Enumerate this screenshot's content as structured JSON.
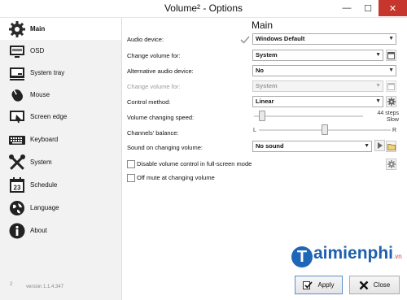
{
  "window": {
    "title": "Volume² - Options",
    "minimize": "—",
    "maximize": "☐",
    "close": "✕"
  },
  "sidebar": {
    "items": [
      {
        "label": "Main",
        "icon": "gear-icon"
      },
      {
        "label": "OSD",
        "icon": "monitor-icon"
      },
      {
        "label": "System tray",
        "icon": "system-tray-icon"
      },
      {
        "label": "Mouse",
        "icon": "mouse-icon"
      },
      {
        "label": "Screen edge",
        "icon": "screen-edge-icon"
      },
      {
        "label": "Keyboard",
        "icon": "keyboard-icon"
      },
      {
        "label": "System",
        "icon": "tools-icon"
      },
      {
        "label": "Schedule",
        "icon": "calendar-icon"
      },
      {
        "label": "Language",
        "icon": "globe-icon"
      },
      {
        "label": "About",
        "icon": "info-icon"
      }
    ],
    "version_superscript": "2",
    "version": "version 1.1.4.347"
  },
  "main": {
    "heading": "Main",
    "audio_device": {
      "label": "Audio device:",
      "value": "Windows Default"
    },
    "change_volume_for": {
      "label": "Change volume for:",
      "value": "System"
    },
    "alt_audio_device": {
      "label": "Alternative audio device:",
      "value": "No"
    },
    "alt_change_volume_for": {
      "label": "Change volume for:",
      "value": "System"
    },
    "control_method": {
      "label": "Control method:",
      "value": "Linear"
    },
    "volume_speed": {
      "label": "Volume changing speed:",
      "steps": "44 steps",
      "speed": "Slow",
      "level": 0.05
    },
    "balance": {
      "label": "Channels' balance:",
      "left": "L",
      "right": "R",
      "level": 0.5
    },
    "sound_on_change": {
      "label": "Sound on changing volume:",
      "value": "No sound"
    },
    "disable_fullscreen": {
      "label": "Disable volume control in full-screen mode",
      "checked": false
    },
    "off_mute": {
      "label": "Off mute at changing volume",
      "checked": false
    }
  },
  "buttons": {
    "apply": "Apply",
    "close": "Close"
  },
  "watermark": {
    "brand": "aimienphi",
    "initial": "T",
    "tld": ".vn"
  }
}
